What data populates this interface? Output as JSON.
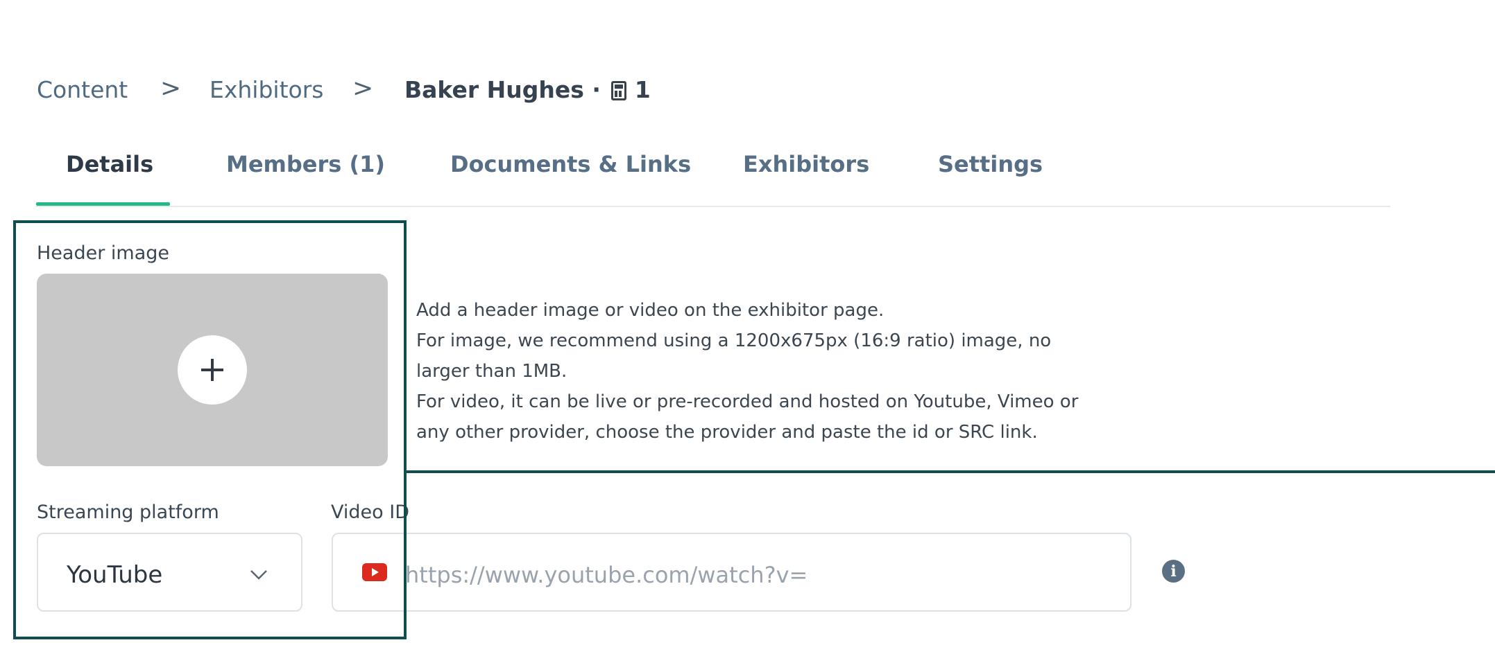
{
  "breadcrumb": {
    "items": [
      {
        "label": "Content"
      },
      {
        "label": "Exhibitors"
      },
      {
        "label": "Baker Hughes · "
      }
    ],
    "current_badge_count": "1",
    "separator": ">"
  },
  "tabs": [
    {
      "label": "Details",
      "active": true
    },
    {
      "label": "Members (1)",
      "active": false
    },
    {
      "label": "Documents & Links",
      "active": false
    },
    {
      "label": "Exhibitors",
      "active": false
    },
    {
      "label": "Settings",
      "active": false
    }
  ],
  "header_image": {
    "label": "Header image",
    "upload_icon": "plus-icon",
    "help_lines": [
      "Add a header image or video on the exhibitor page.",
      "For image, we recommend using a 1200x675px (16:9 ratio) image, no",
      "larger than 1MB.",
      "For video, it can be live or pre-recorded and hosted on Youtube, Vimeo or",
      "any other provider, choose the provider and paste the id or SRC link."
    ]
  },
  "streaming": {
    "label": "Streaming platform",
    "selected": "YouTube",
    "dropdown_icon": "chevron-down-icon"
  },
  "video": {
    "label": "Video ID",
    "placeholder": "https://www.youtube.com/watch?v=",
    "platform_icon": "youtube-icon",
    "info_icon": "info-icon"
  },
  "colors": {
    "accent": "#27b888",
    "highlight": "#0f4e4e",
    "youtube": "#dc2a1f",
    "info": "#5a6f83"
  }
}
